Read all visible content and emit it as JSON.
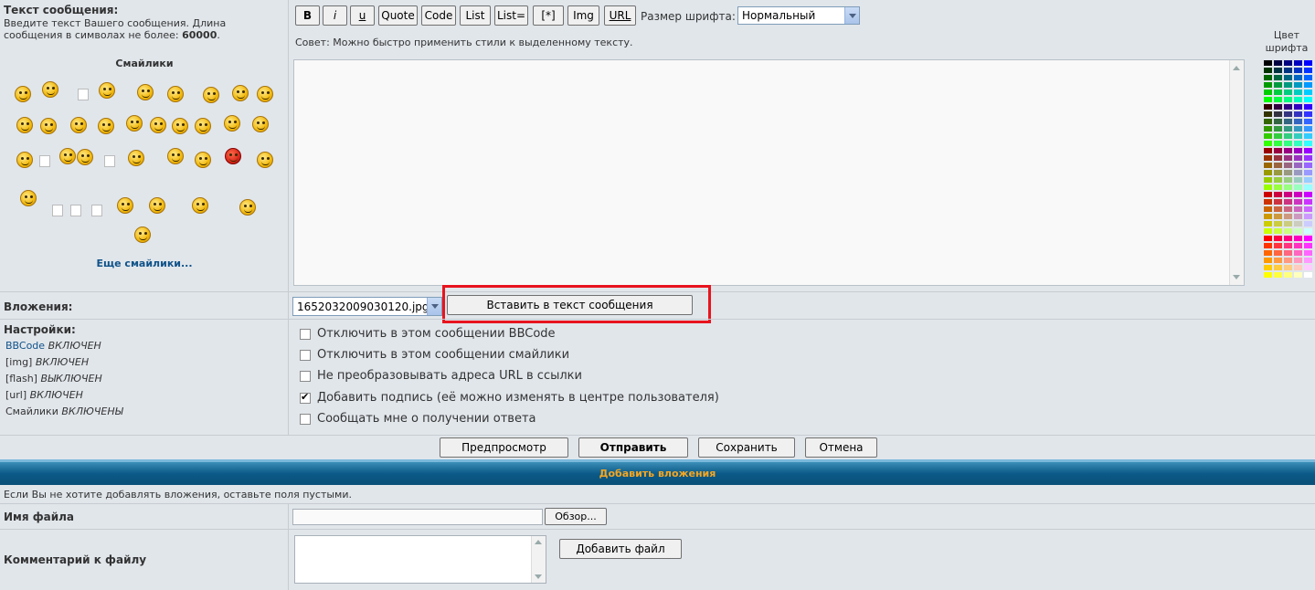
{
  "message": {
    "label": "Текст сообщения:",
    "hint_text": "Введите текст Вашего сообщения. Длина сообщения в символах не более:",
    "hint_limit": "60000",
    "smilies_title": "Смайлики",
    "more_smilies": "Еще смайлики...",
    "tip": "Совет: Можно быстро применить стили к выделенному тексту."
  },
  "toolbar": {
    "buttons": [
      "B",
      "i",
      "u",
      "Quote",
      "Code",
      "List",
      "List=",
      "[*]",
      "Img",
      "URL"
    ],
    "font_size_label": "Размер шрифта:",
    "font_size_value": "Нормальный",
    "font_color_label": "Цвет шрифта"
  },
  "attachments": {
    "label": "Вложения:",
    "file_select": "1652032009030120.jpg",
    "insert_button": "Вставить в текст сообщения"
  },
  "settings": {
    "label": "Настройки:",
    "status": [
      {
        "name": "BBCode",
        "state": "ВКЛЮЧЕН"
      },
      {
        "name": "[img]",
        "state": "ВКЛЮЧЕН"
      },
      {
        "name": "[flash]",
        "state": "ВЫКЛЮЧЕН"
      },
      {
        "name": "[url]",
        "state": "ВКЛЮЧЕН"
      },
      {
        "name": "Смайлики",
        "state": "ВКЛЮЧЕНЫ"
      }
    ],
    "options": [
      {
        "label": "Отключить в этом сообщении BBCode",
        "checked": false
      },
      {
        "label": "Отключить в этом сообщении смайлики",
        "checked": false
      },
      {
        "label": "Не преобразовывать адреса URL в ссылки",
        "checked": false
      },
      {
        "label": "Добавить подпись (её можно изменять в центре пользователя)",
        "checked": true
      },
      {
        "label": "Сообщать мне о получении ответа",
        "checked": false
      }
    ]
  },
  "actions": {
    "preview": "Предпросмотр",
    "submit": "Отправить",
    "save": "Сохранить",
    "cancel": "Отмена"
  },
  "add_attachment": {
    "header": "Добавить вложения",
    "note": "Если Вы не хотите добавлять вложения, оставьте поля пустыми.",
    "filename_label": "Имя файла",
    "browse": "Обзор...",
    "comment_label": "Комментарий к файлу",
    "add_file": "Добавить файл"
  },
  "colors": {
    "highlight": "#e8141e",
    "header_text": "#f5a623"
  }
}
